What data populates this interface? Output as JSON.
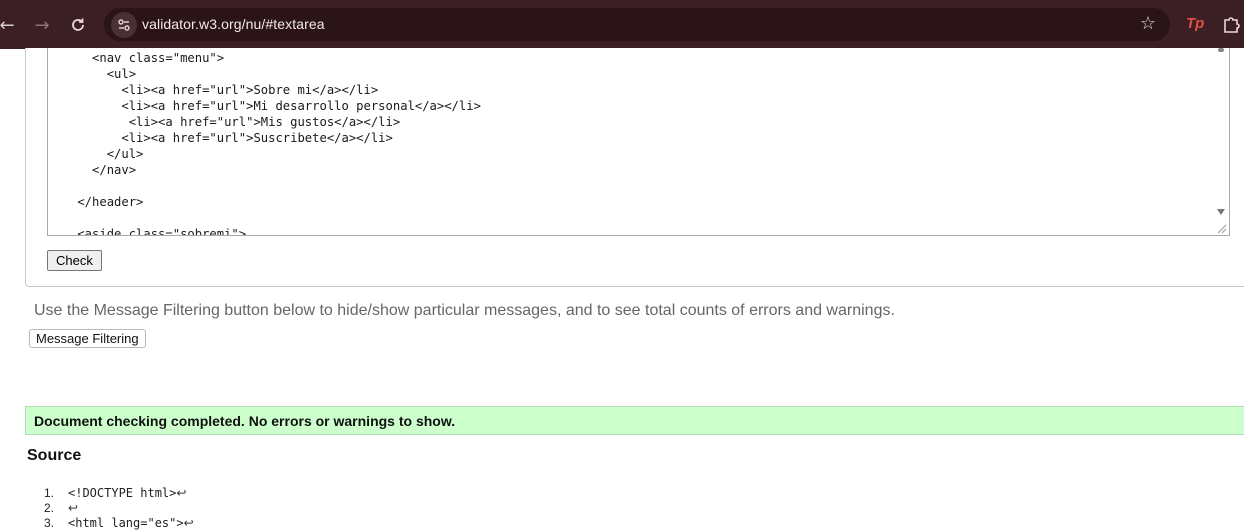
{
  "browser": {
    "url": "validator.w3.org/nu/#textarea",
    "extension_label": "Tp"
  },
  "textarea": {
    "lines": [
      "      <nav class=\"menu\">",
      "        <ul>",
      "          <li><a href=\"url\">Sobre mi</a></li>",
      "          <li><a href=\"url\">Mi desarrollo personal</a></li>",
      "           <li><a href=\"url\">Mis gustos</a></li>",
      "          <li><a href=\"url\">Suscribete</a></li>",
      "        </ul>",
      "      </nav>",
      "",
      "    </header>",
      "",
      "    <aside class=\"sobremi\">"
    ]
  },
  "form": {
    "check_label": "Check"
  },
  "filtering": {
    "info": "Use the Message Filtering button below to hide/show particular messages, and to see total counts of errors and warnings.",
    "button_label": "Message Filtering"
  },
  "result": {
    "message": "Document checking completed. No errors or warnings to show."
  },
  "source": {
    "title": "Source",
    "lines": [
      {
        "num": "1.",
        "text": "<!DOCTYPE html>",
        "ret": "↩"
      },
      {
        "num": "2.",
        "text": "",
        "ret": "↩"
      },
      {
        "num": "3.",
        "text": "<html lang=\"es\">",
        "ret": "↩"
      }
    ]
  }
}
